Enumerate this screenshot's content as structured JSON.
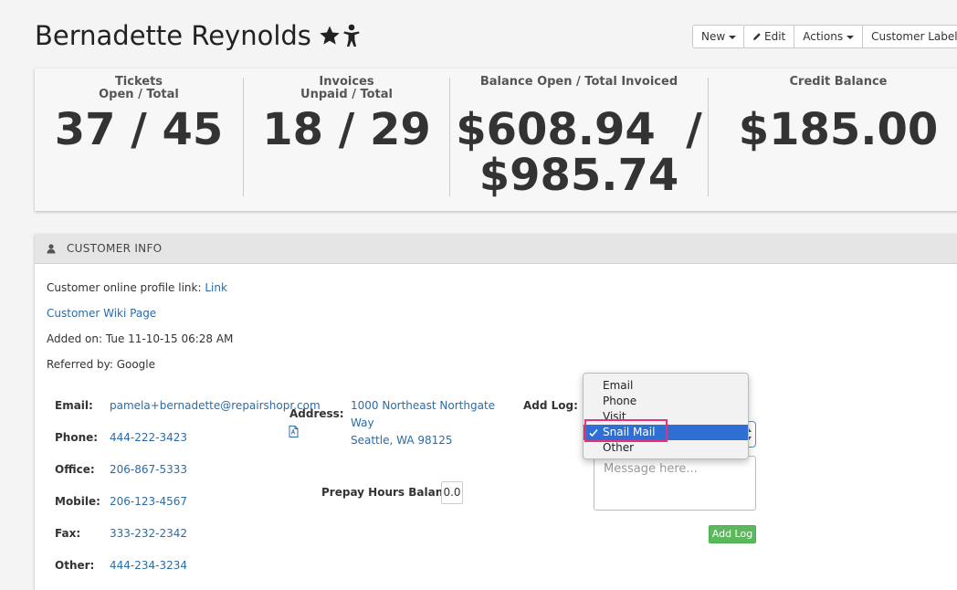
{
  "customer": {
    "name": "Bernadette Reynolds"
  },
  "icons": {
    "title": [
      "star-icon",
      "person-icon"
    ],
    "panel": "user-icon",
    "pdf": "pdf-icon",
    "check": "check-icon"
  },
  "toolbar": {
    "new_label": "New",
    "edit_label": "Edit",
    "actions_label": "Actions",
    "labels_label": "Customer Labels"
  },
  "stats": [
    {
      "label1": "Tickets",
      "label2": "Open / Total",
      "value": "37 / 45"
    },
    {
      "label1": "Invoices",
      "label2": "Unpaid / Total",
      "value": "18 / 29"
    },
    {
      "label1": "Balance Open / Total Invoiced",
      "value1": "$608.94  /",
      "value2": "$985.74"
    },
    {
      "label1": "Credit Balance",
      "value": "$185.00"
    }
  ],
  "panel": {
    "title": "CUSTOMER INFO",
    "profile_prefix": "Customer online profile link:",
    "profile_link": "Link",
    "wiki_link": "Customer Wiki Page",
    "added_on": "Added on: Tue 11-10-15 06:28 AM",
    "referred_by": "Referred by: Google"
  },
  "contact": [
    {
      "label": "Email:",
      "value": "pamela+bernadette@repairshopr.com"
    },
    {
      "label": "Phone:",
      "value": "444-222-3423"
    },
    {
      "label": "Office:",
      "value": "206-867-5333"
    },
    {
      "label": "Mobile:",
      "value": "206-123-4567"
    },
    {
      "label": "Fax:",
      "value": "333-232-2342"
    },
    {
      "label": "Other:",
      "value": "444-234-3234"
    }
  ],
  "address": {
    "label": "Address:",
    "line1": "1000 Northeast Northgate",
    "line2": "Way",
    "line3": "Seattle, WA 98125"
  },
  "prepay": {
    "label": "Prepay Hours Balance:",
    "value": "0.0"
  },
  "log": {
    "label": "Add Log:",
    "options": [
      "Email",
      "Phone",
      "Visit",
      "Snail Mail",
      "Other"
    ],
    "selected": "Snail Mail",
    "placeholder": "Message here...",
    "button": "Add Log"
  },
  "colors": {
    "accent": "#2f6fd3",
    "highlight": "#e8317a",
    "success": "#5cb85c",
    "link": "#2a6ca8"
  }
}
